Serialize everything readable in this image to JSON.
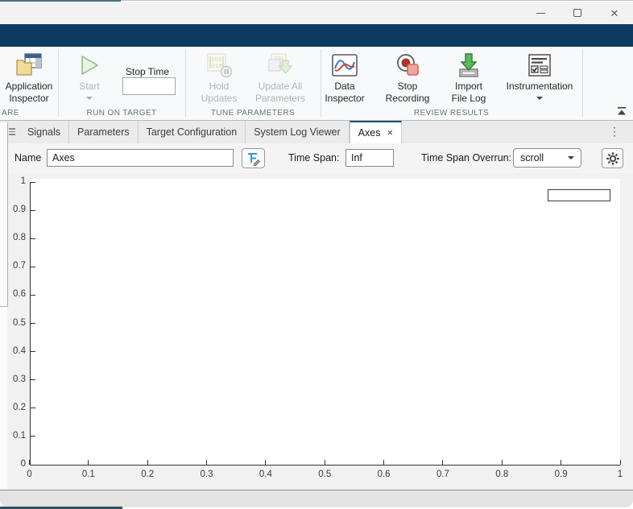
{
  "colors": {
    "ribbon_band": "#0c3a61",
    "active_tab_stripe": "#15537d",
    "start_green": "#9cc294",
    "record_red": "#aa3528",
    "import_green": "#5cb85c",
    "inspector_blue": "#3a7ac2",
    "inspector_red": "#c24a42",
    "behind_teal": "#47707f"
  },
  "window": {
    "close_glyph": "✕",
    "controls": [
      "minimize",
      "maximize",
      "close"
    ]
  },
  "ribbon": {
    "groups": [
      "ARE",
      "RUN ON TARGET",
      "TUNE PARAMETERS",
      "REVIEW RESULTS"
    ],
    "items": {
      "application_inspector": {
        "label": "Application\nInspector",
        "enabled": true
      },
      "start": {
        "label": "Start",
        "enabled": false
      },
      "stop_time": {
        "label": "Stop Time",
        "value": ""
      },
      "hold_updates": {
        "label": "Hold\nUpdates",
        "enabled": false
      },
      "update_all_parameters": {
        "label": "Update All\nParameters",
        "enabled": false
      },
      "data_inspector": {
        "label": "Data\nInspector",
        "enabled": true
      },
      "stop_recording": {
        "label": "Stop\nRecording",
        "enabled": true
      },
      "import_file_log": {
        "label": "Import\nFile Log",
        "enabled": true
      },
      "instrumentation": {
        "label": "Instrumentation",
        "enabled": true
      }
    }
  },
  "tabs": {
    "items": [
      "Signals",
      "Parameters",
      "Target Configuration",
      "System Log Viewer",
      "Axes"
    ],
    "active": "Axes",
    "close_glyph": "×",
    "overflow_glyph": "⋮"
  },
  "controls": {
    "name_label": "Name",
    "name_value": "Axes",
    "time_span_label": "Time Span:",
    "time_span_value": "Inf",
    "overrun_label": "Time Span Overrun:",
    "overrun_value": "scroll"
  },
  "chart_data": {
    "type": "line",
    "series": [],
    "title": "",
    "xlabel": "",
    "ylabel": "",
    "xlim": [
      0,
      1
    ],
    "ylim": [
      0,
      1
    ],
    "grid": false,
    "legend": {
      "position": "top-right",
      "entries": []
    },
    "x_ticks": [
      "0",
      "0.1",
      "0.2",
      "0.3",
      "0.4",
      "0.5",
      "0.6",
      "0.7",
      "0.8",
      "0.9",
      "1"
    ],
    "y_ticks": [
      "1",
      "0.9",
      "0.8",
      "0.7",
      "0.6",
      "0.5",
      "0.4",
      "0.3",
      "0.2",
      "0.1",
      "0"
    ]
  }
}
